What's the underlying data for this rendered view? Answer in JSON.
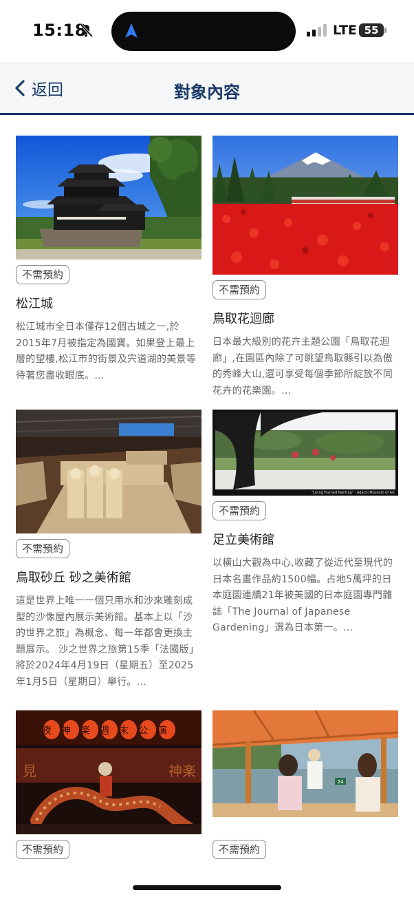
{
  "status_bar": {
    "time": "15:18",
    "network": "LTE",
    "battery": "55"
  },
  "header": {
    "back_label": "返回",
    "title": "對象內容"
  },
  "cards": [
    {
      "badge": "不需預約",
      "title": "松江城",
      "description": "松江城市全日本僅存12個古城之一,於2015年7月被指定為國寶。如果登上最上層的望樓,松江市的街景及宍道湖的美景等待著您盡收眼底。..."
    },
    {
      "badge": "不需預約",
      "title": "鳥取花迴廊",
      "description": "日本最大級別的花卉主題公園「鳥取花迴廊」,在園區內除了可眺望鳥取縣引以為傲的秀峰大山,還可享受每個季節所綻放不同花卉的花樂園。..."
    },
    {
      "badge": "不需預約",
      "title": "鳥取砂丘 砂之美術館",
      "description": "這是世界上唯一一個只用水和沙來雕刻成型的沙像屋內展示美術館。基本上以「沙的世界之旅」為概念、每一年都會更換主題展示。 沙之世界之旅第15季「法國版」將於2024年4月19日（星期五）至2025年1月5日（星期日）舉行。..."
    },
    {
      "badge": "不需預約",
      "title": "足立美術館",
      "description": "以橫山大觀為中心,收藏了從近代至現代的日本名畫作品約1500幅。占地5萬坪的日本庭園連續21年被美國的日本庭園專門雜誌「The Journal of Japanese Gardening」選為日本第一。...",
      "image_caption": "\"Living Framed Painting\" · Adachi Museum of Art"
    },
    {
      "badge": "不需預約"
    },
    {
      "badge": "不需預約"
    }
  ],
  "kagura_banner": "夜神楽週末公演",
  "kagura_side_left": "見",
  "kagura_side_right": "神楽",
  "boat_number": "24"
}
